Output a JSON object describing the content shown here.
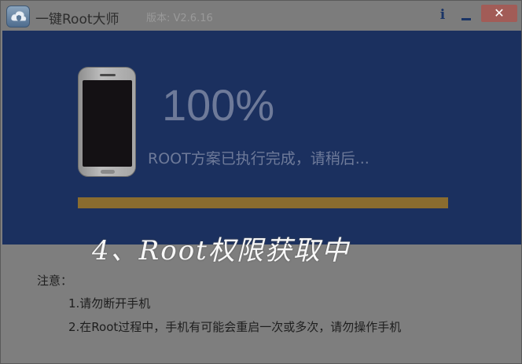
{
  "window": {
    "title": "一键Root大师",
    "version": "版本: V2.6.16",
    "info_label": "i",
    "close_label": "✕"
  },
  "progress": {
    "percent_text": "100%",
    "fraction": 1.0,
    "status": "ROOT方案已执行完成，请稍后...",
    "fill_color": "#8a6c2f",
    "panel_color": "#1b305f"
  },
  "caption": "4、Root权限获取中",
  "notes": {
    "title": "注意：",
    "items": [
      "1.请勿断开手机",
      "2.在Root过程中，手机有可能会重启一次或多次，请勿操作手机"
    ]
  }
}
